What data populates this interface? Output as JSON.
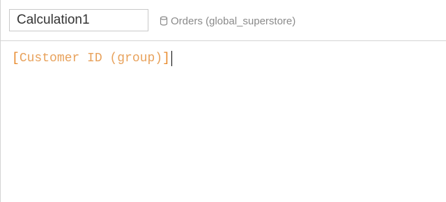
{
  "calculation": {
    "name": "Calculation1"
  },
  "datasource": {
    "icon": "database-icon",
    "label": "Orders (global_superstore)"
  },
  "formula": {
    "open_bracket": "[",
    "field": "Customer ID (group)",
    "close_bracket": "]"
  },
  "colors": {
    "bracket": "#e8892a",
    "field": "#e8a25c",
    "source_text": "#8a8a8a"
  }
}
